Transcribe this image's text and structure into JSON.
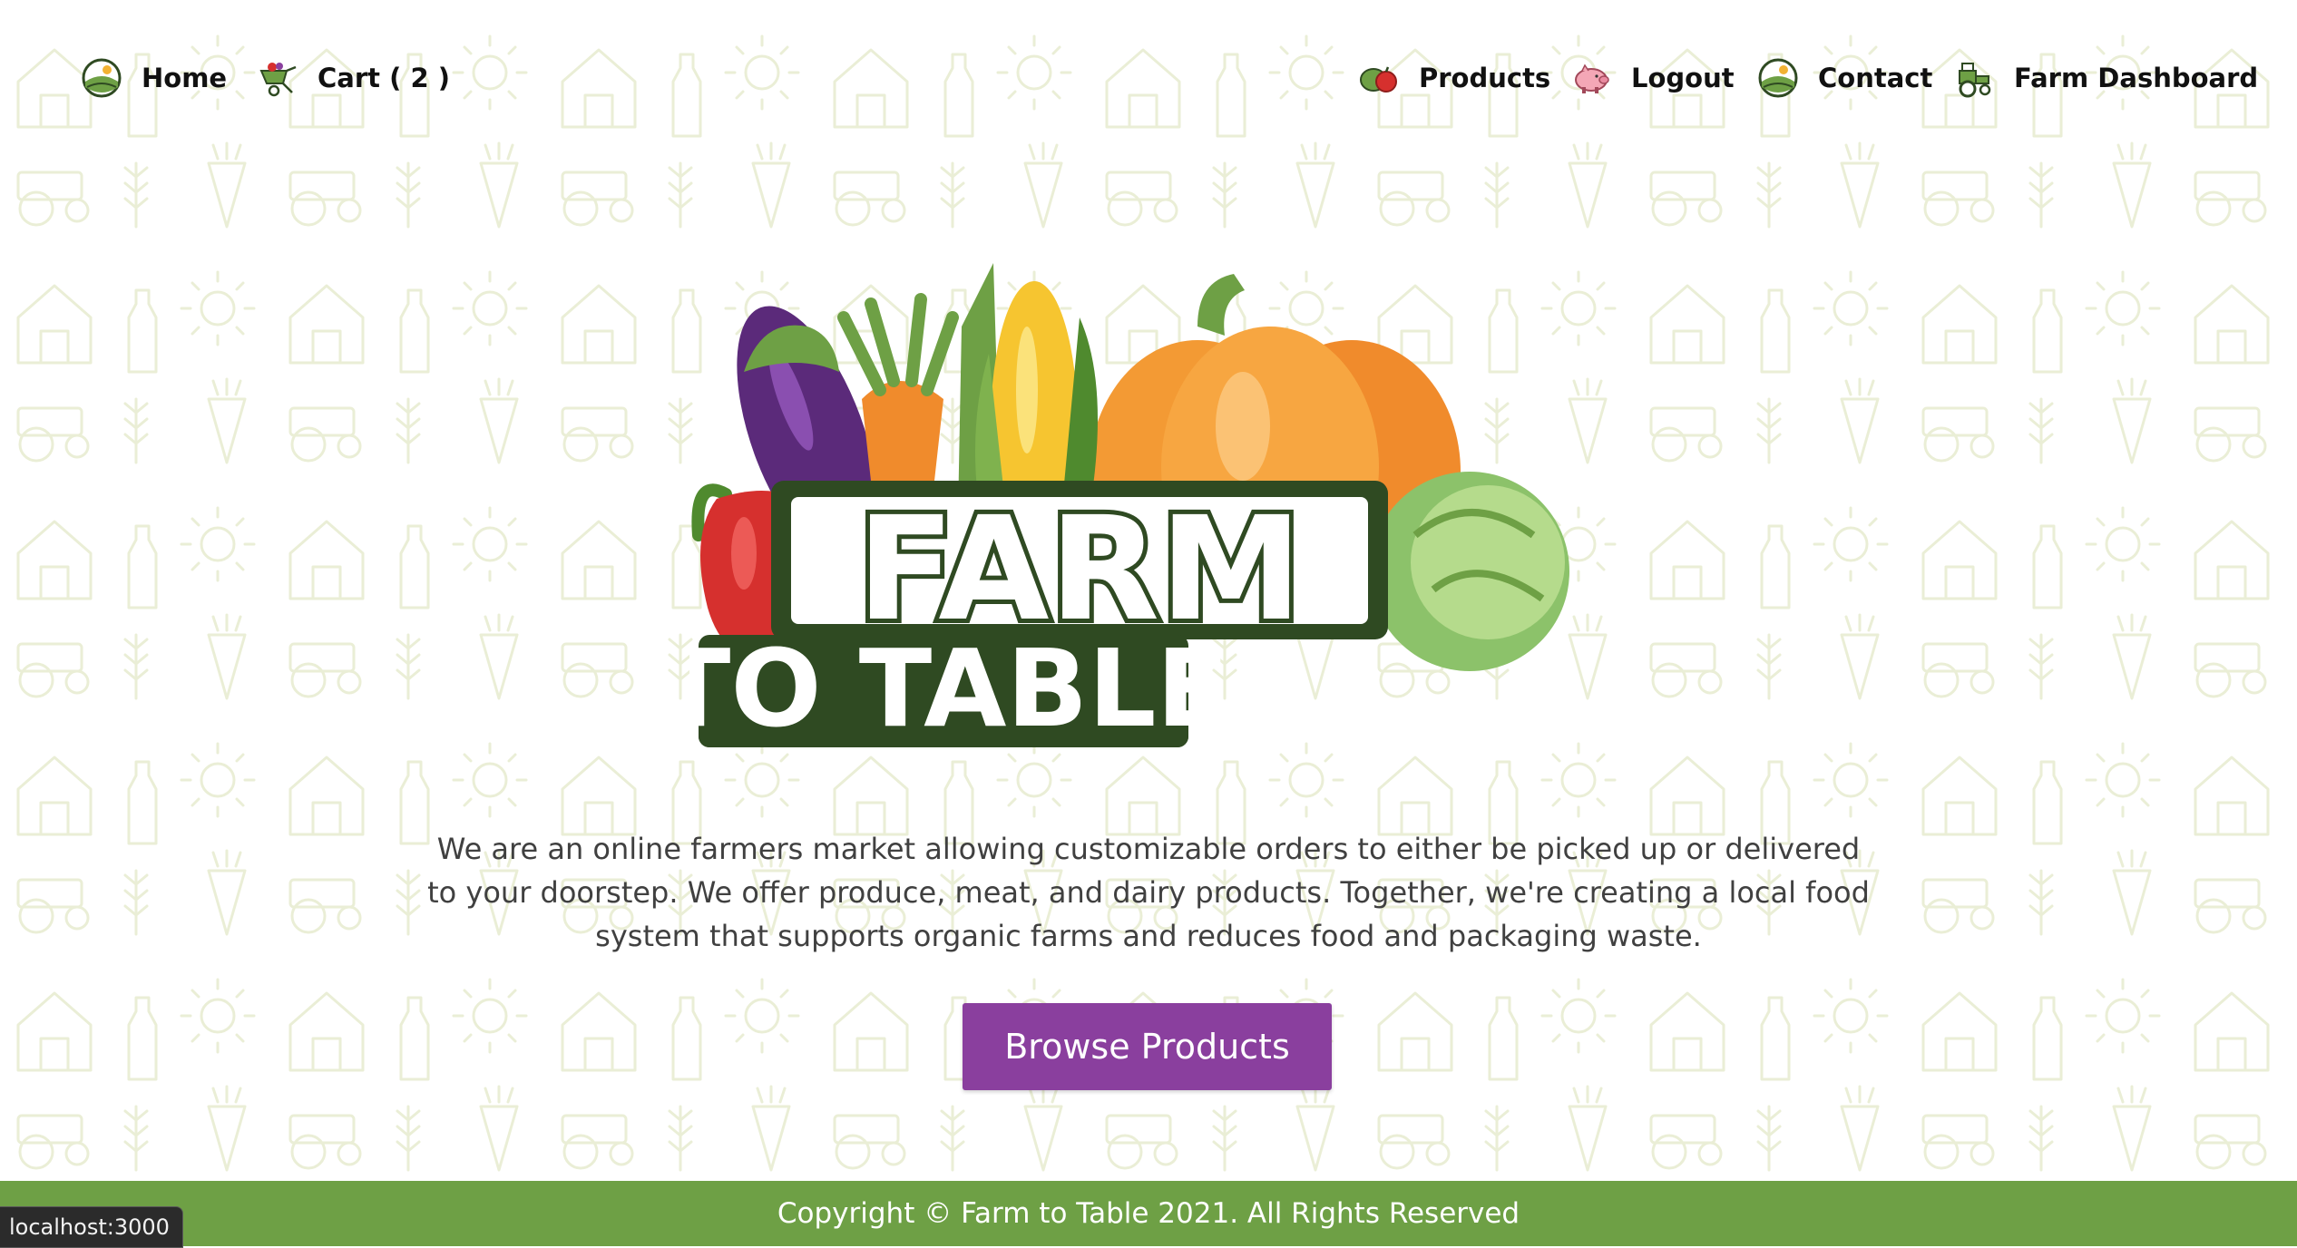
{
  "nav": {
    "home": {
      "label": "Home",
      "icon": "farm-landscape-icon"
    },
    "cart": {
      "label": "Cart ( 2 )",
      "icon": "wheelbarrow-icon"
    },
    "products": {
      "label": "Products",
      "icon": "produce-icon"
    },
    "logout": {
      "label": "Logout",
      "icon": "pig-icon"
    },
    "contact": {
      "label": "Contact",
      "icon": "farm-landscape-icon"
    },
    "dashboard": {
      "label": "Farm Dashboard",
      "icon": "tractor-icon"
    }
  },
  "hero": {
    "logo": {
      "line1": "FARM",
      "line2": "TO TABLE"
    },
    "description": "We are an online farmers market allowing customizable orders to either be picked up or delivered to your doorstep. We offer produce, meat, and dairy products. Together, we're creating a local food system that supports organic farms and reduces food and packaging waste.",
    "button_label": "Browse Products"
  },
  "footer": {
    "text": "Copyright © Farm to Table 2021. All Rights Reserved"
  },
  "status_bar": {
    "url": "localhost:3000"
  },
  "colors": {
    "accent_purple": "#8a3f9e",
    "footer_green": "#6ea045",
    "logo_dark_green": "#2f4a22",
    "pattern_tint": "#eef0dc"
  }
}
